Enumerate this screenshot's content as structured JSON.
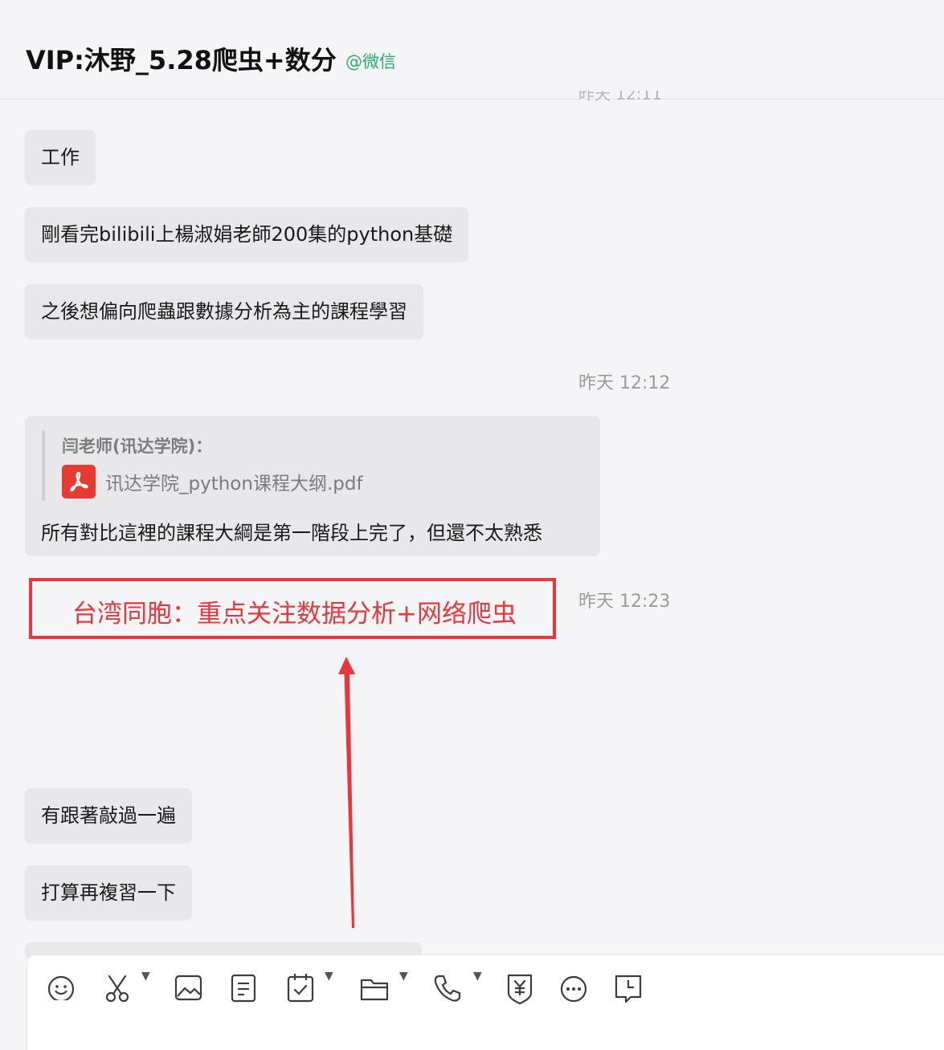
{
  "header": {
    "title": "VIP:沐野_5.28爬虫+数分",
    "source_tag": "@微信",
    "top_timestamp_residue": "昨天 12:11"
  },
  "messages": {
    "m1": "工作",
    "m2": "剛看完bilibili上楊淑娟老師200集的python基礎",
    "m3": "之後想偏向爬蟲跟數據分析為主的課程學習",
    "time1": "昨天 12:12",
    "quote": {
      "sender": "闫老师(讯达学院)：",
      "file_name": "讯达学院_python课程大纲.pdf",
      "reply": "所有對比這裡的課程大綱是第一階段上完了，但還不太熟悉"
    },
    "time2": "昨天 12:23",
    "m5": "有跟著敲過一遍",
    "m6": "打算再複習一下"
  },
  "annotation": {
    "text": "台湾同胞：重点关注数据分析+网络爬虫",
    "color": "#e8363d"
  },
  "toolbar": {
    "icons": [
      "emoji-icon",
      "scissors-icon",
      "image-icon",
      "document-icon",
      "task-icon",
      "folder-icon",
      "phone-icon",
      "yuan-shield-icon",
      "more-icon",
      "chat-history-icon"
    ]
  },
  "colors": {
    "background": "#f5f5f7",
    "bubble": "#e8e8ea",
    "source_tag": "#2aae67",
    "pdf": "#e53b30"
  }
}
